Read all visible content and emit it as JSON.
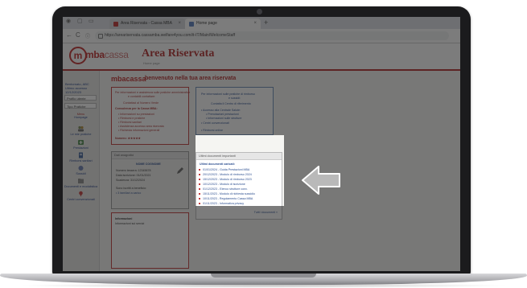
{
  "browser": {
    "tabs": [
      {
        "label": "Area Riservata - Cassa MBA"
      },
      {
        "label": "Home page"
      }
    ],
    "new_tab": "+",
    "url": "https://areariservata.cassamba.welfare4you.com/it-IT/Main/WelcomeStaff",
    "nav": {
      "back": "←",
      "forward": "→",
      "reload": "C",
      "info": "ⓘ"
    }
  },
  "header": {
    "logo_text": "mba",
    "logo_text2": "cassa",
    "logo_tagline": "",
    "title": "Area Riservata",
    "subtitle": "Home page"
  },
  "sidebar": {
    "user_line1": "Bentornato, ABC",
    "user_line2": "Ultimo accesso 12/12/2023",
    "select1": "Profilo utente",
    "select2": "Tipo Pratiche",
    "items": [
      {
        "label": "Hompage",
        "top_label": "Menu"
      },
      {
        "label": "Le mie pratiche"
      },
      {
        "label": "Prestazioni"
      },
      {
        "label": "Rimborsi sanitari"
      },
      {
        "label": "Sussidi"
      },
      {
        "label": "Documenti e modulistica"
      },
      {
        "label": "Centri convenzionati"
      },
      {
        "label": "Contatti"
      }
    ]
  },
  "main": {
    "welcome_logo": "mbacassa",
    "welcome_text": "benvenuto nella tua area riservata",
    "box1_lines": [
      "Per informazioni e assistenza sulle pratiche amministrative",
      "e contabili contattare:",
      "Contattaci al Numero Verde",
      "Consulenza per la Cassa MBA:",
      "• Informazioni su prestazioni",
      "• Rimborsi e pratiche",
      "• Rimborsi sanitari",
      "• Assistenza accesso area riservata",
      "• Richiesta informazioni generali",
      "Numero: ★★★★★"
    ],
    "box2_lines": [
      "Per informazioni sulle pratiche di rimborso",
      "e sussidi:",
      "Contatta il Centro di riferimento",
      "• Accesso alla Centrale Salute:",
      "• Prenotazioni prestazioni",
      "• Informazioni sulle strutture",
      "• Centri convenzionati",
      "• Rimborsi online"
    ],
    "box3_header": "Dati anagrafici",
    "box3_lines": [
      "NOME COGNOME",
      "Numero tessera: 12345678",
      "Data iscrizione: 01/01/2021",
      "Scadenza: 31/12/2024",
      "Sono iscritti a beneficio:",
      "• 3 familiari a carico"
    ],
    "box4_header": "Informazioni",
    "box4_lines": [
      "Informazioni sui servizi"
    ],
    "docs_header": "Ultimi documenti importanti",
    "docs_title": "Ultimi documenti caricati:",
    "docs": [
      "01/01/2024 - Guida Prestazioni MBA",
      "20/12/2023 - Modulo di rimborso 2024",
      "15/12/2023 - Modulo di rimborso 2023",
      "10/12/2023 - Modulo di iscrizione",
      "01/12/2023 - Elenco strutture conv.",
      "15/11/2023 - Modulo di richiesta sussidio",
      "10/11/2023 - Regolamento Cassa MBA",
      "01/11/2023 - Informativa privacy"
    ],
    "docs_more": "Tutti i documenti »"
  },
  "colors": {
    "brand_red": "#b22b2b",
    "link_blue": "#2a4d8f",
    "overlay": "#1e1e1e",
    "arrow": "#b9b9b9"
  }
}
